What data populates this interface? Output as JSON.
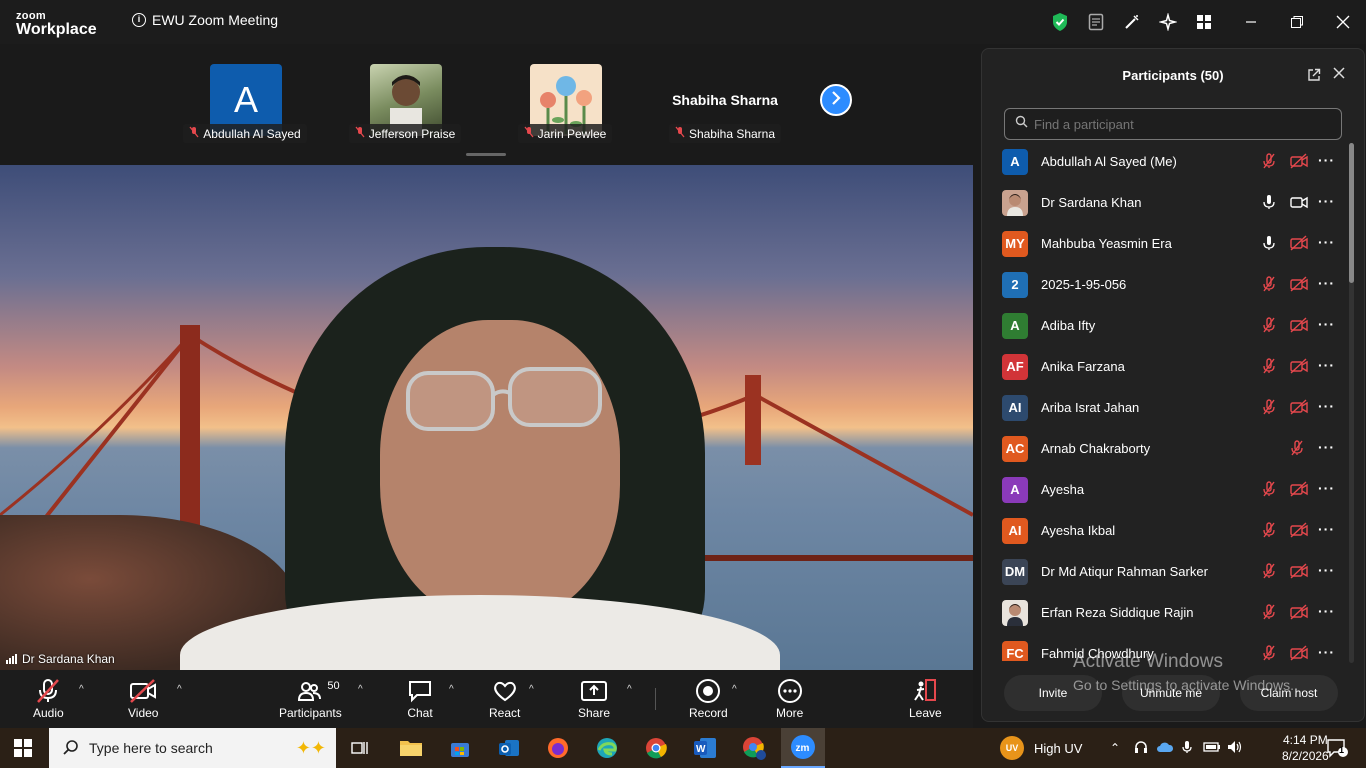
{
  "window": {
    "brand_top": "zoom",
    "brand_bottom": "Workplace",
    "meeting_title": "EWU Zoom Meeting"
  },
  "gallery": {
    "tiles": [
      {
        "name": "Abdullah Al Sayed",
        "avatar": "A",
        "avatar_color": "#0e5cad"
      },
      {
        "name": "Jefferson Praise",
        "avatar": "photo"
      },
      {
        "name": "Jarin Pewlee",
        "avatar": "photo"
      },
      {
        "name": "Shabiha Sharna",
        "display": "Shabiha Sharna"
      }
    ]
  },
  "video": {
    "speaker_name": "Dr Sardana Khan"
  },
  "toolbar": {
    "audio": "Audio",
    "video": "Video",
    "participants": "Participants",
    "participants_count": "50",
    "chat": "Chat",
    "react": "React",
    "share": "Share",
    "record": "Record",
    "more": "More",
    "leave": "Leave"
  },
  "panel": {
    "title": "Participants (50)",
    "search_placeholder": "Find a participant",
    "participants": [
      {
        "name": "Abdullah Al Sayed (Me)",
        "initials": "A",
        "color": "#0e5cad",
        "mic": "muted",
        "cam": "off"
      },
      {
        "name": "Dr Sardana Khan",
        "initials": "",
        "color": "#c9a28f",
        "photo": true,
        "mic": "on",
        "cam": "on"
      },
      {
        "name": "Mahbuba Yeasmin Era",
        "initials": "MY",
        "color": "#e0591f",
        "mic": "on",
        "cam": "off"
      },
      {
        "name": "2025-1-95-056",
        "initials": "2",
        "color": "#1f6fb5",
        "mic": "muted",
        "cam": "off"
      },
      {
        "name": "Adiba Ifty",
        "initials": "A",
        "color": "#2f7d32",
        "mic": "muted",
        "cam": "off"
      },
      {
        "name": "Anika Farzana",
        "initials": "AF",
        "color": "#d13438",
        "mic": "muted",
        "cam": "off"
      },
      {
        "name": "Ariba Israt Jahan",
        "initials": "AI",
        "color": "#2d4a6e",
        "mic": "muted",
        "cam": "off"
      },
      {
        "name": "Arnab Chakraborty",
        "initials": "AC",
        "color": "#e0591f",
        "mic": "none",
        "cam": "muted-only"
      },
      {
        "name": "Ayesha",
        "initials": "A",
        "color": "#8a3ab9",
        "mic": "muted",
        "cam": "off"
      },
      {
        "name": "Ayesha Ikbal",
        "initials": "AI",
        "color": "#e0591f",
        "mic": "muted",
        "cam": "off"
      },
      {
        "name": "Dr Md Atiqur Rahman Sarker",
        "initials": "DM",
        "color": "#3b4556",
        "mic": "muted",
        "cam": "off"
      },
      {
        "name": "Erfan Reza Siddique Rajin",
        "initials": "",
        "color": "#e8e3dc",
        "photo": true,
        "mic": "muted",
        "cam": "off"
      },
      {
        "name": "Fahmid Chowdhury",
        "initials": "FC",
        "color": "#e0591f",
        "mic": "muted",
        "cam": "off"
      }
    ],
    "invite": "Invite",
    "unmute_me": "Unmute me",
    "claim_host": "Claim host"
  },
  "watermark": {
    "line1": "Activate Windows",
    "line2": "Go to Settings to activate Windows."
  },
  "taskbar": {
    "search_placeholder": "Type here to search",
    "weather": "High UV",
    "time": "4:14 PM",
    "date": "8/2/2026",
    "notif_count": "1"
  }
}
